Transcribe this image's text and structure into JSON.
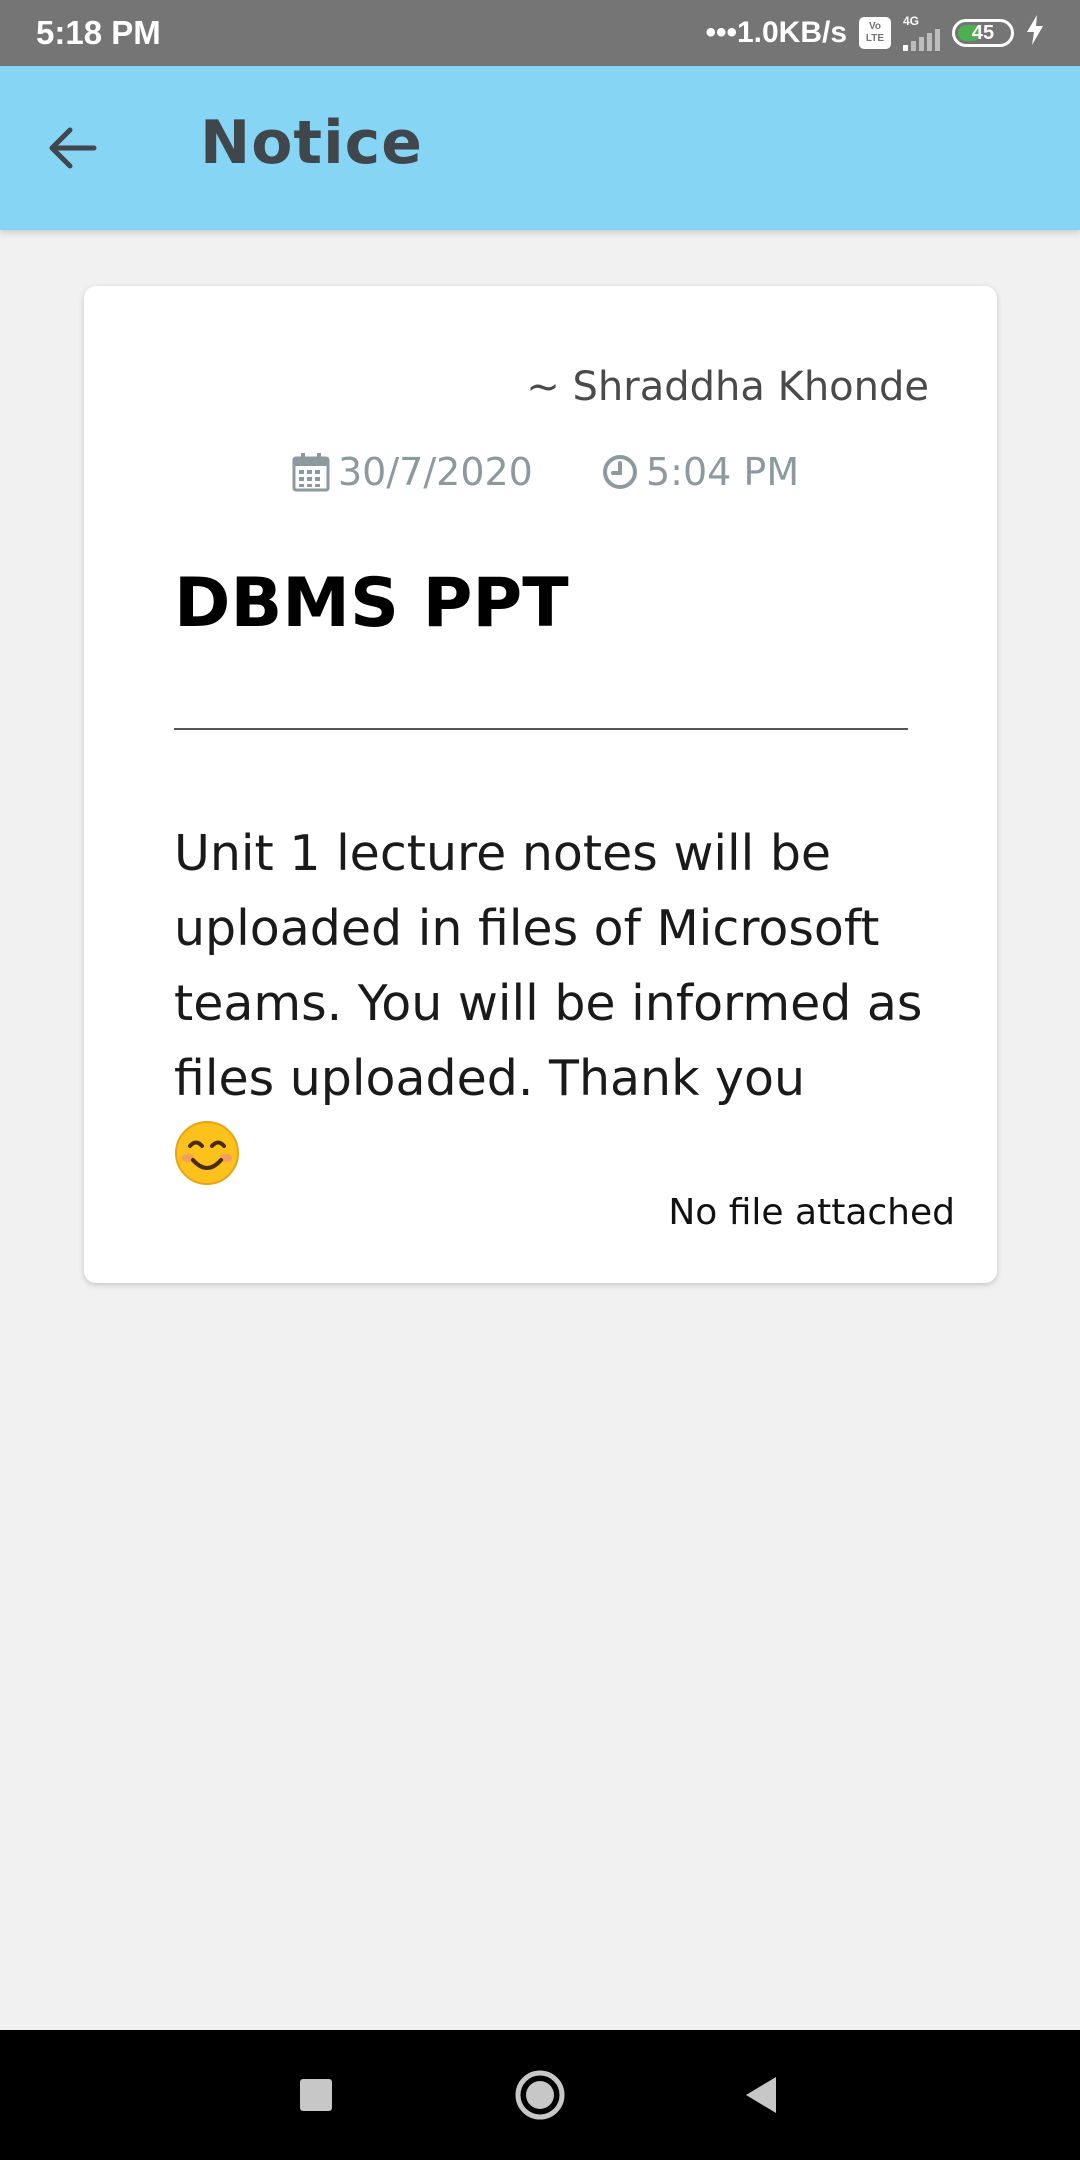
{
  "status_bar": {
    "time": "5:18 PM",
    "speed": "•••1.0KB/s",
    "volte_top": "Vo",
    "volte_bottom": "LTE",
    "network_type": "4G",
    "battery_level": "45",
    "icons": [
      "volte-icon",
      "signal-icon",
      "battery-icon",
      "charging-bolt-icon"
    ]
  },
  "app_bar": {
    "title": "Notice",
    "back_icon": "arrow-left-icon",
    "background_color": "#87d5f5"
  },
  "notice": {
    "author": "~ Shraddha Khonde",
    "date": "30/7/2020",
    "time": "5:04 PM",
    "title": "DBMS PPT",
    "body": "Unit 1 lecture notes will be uploaded in files of Microsoft teams. You will be informed as files uploaded. Thank you",
    "emoji": "smiling-face-icon",
    "attachment": "No file attached",
    "date_icon": "calendar-icon",
    "time_icon": "clock-icon"
  },
  "nav_bar": {
    "buttons": [
      "recents-square-icon",
      "home-circle-icon",
      "back-triangle-icon"
    ]
  }
}
